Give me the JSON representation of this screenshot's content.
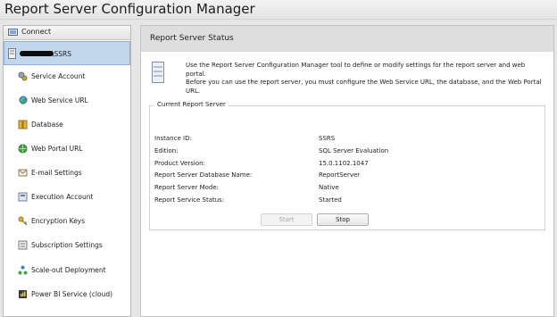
{
  "window": {
    "title": "Report Server Configuration Manager"
  },
  "sidebar": {
    "connect_label": "Connect",
    "server_name": "\\SSRS",
    "items": [
      {
        "label": "Service Account",
        "icon": "service-account-icon"
      },
      {
        "label": "Web Service URL",
        "icon": "web-service-url-icon"
      },
      {
        "label": "Database",
        "icon": "database-icon"
      },
      {
        "label": "Web Portal URL",
        "icon": "web-portal-url-icon"
      },
      {
        "label": "E-mail Settings",
        "icon": "email-icon"
      },
      {
        "label": "Execution Account",
        "icon": "execution-account-icon"
      },
      {
        "label": "Encryption Keys",
        "icon": "encryption-keys-icon"
      },
      {
        "label": "Subscription Settings",
        "icon": "subscription-settings-icon"
      },
      {
        "label": "Scale-out Deployment",
        "icon": "scale-out-deployment-icon"
      },
      {
        "label": "Power BI Service (cloud)",
        "icon": "power-bi-icon"
      }
    ]
  },
  "main": {
    "title": "Report Server Status",
    "intro_lines": [
      "Use the Report Server Configuration Manager tool to define or modify settings for the report server and web portal.",
      "Before you can use the report server, you must configure the Web Service URL, the database, and the Web Portal",
      "URL."
    ],
    "group_title": "Current Report Server",
    "info": [
      {
        "label": "Instance ID:",
        "value": "SSRS"
      },
      {
        "label": "Edition:",
        "value": "SQL Server Evaluation"
      },
      {
        "label": "Product Version:",
        "value": "15.0.1102.1047"
      },
      {
        "label": "Report Server Database Name:",
        "value": "ReportServer"
      },
      {
        "label": "Report Server Mode:",
        "value": "Native"
      },
      {
        "label": "Report Service Status:",
        "value": "Started"
      }
    ],
    "buttons": {
      "start": "Start",
      "stop": "Stop"
    }
  }
}
